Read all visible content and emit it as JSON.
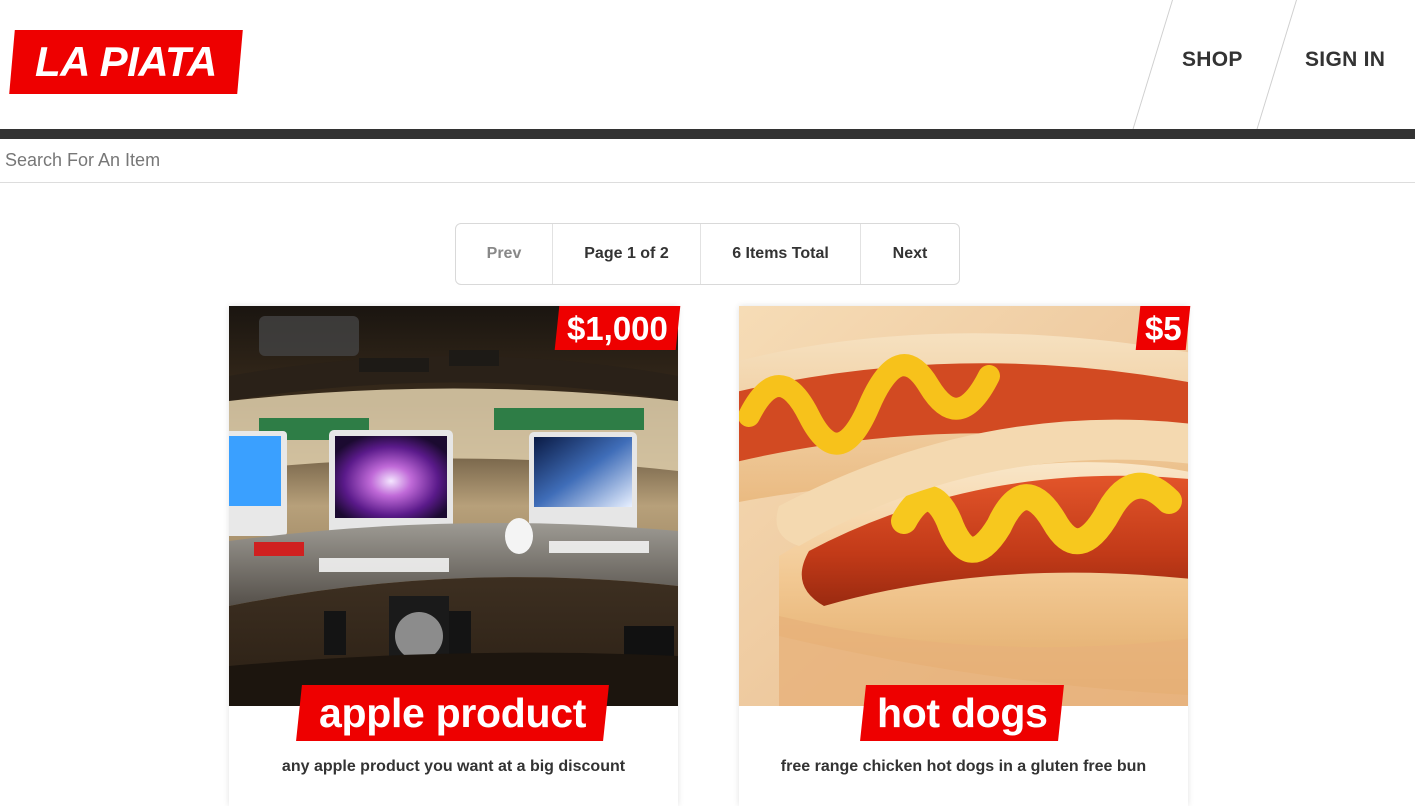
{
  "header": {
    "logo": "LA PIATA",
    "nav": [
      {
        "label": "SHOP"
      },
      {
        "label": "SIGN IN"
      }
    ]
  },
  "search": {
    "placeholder": "Search For An Item",
    "value": ""
  },
  "pagination": {
    "prev_label": "Prev",
    "page_label": "Page 1 of 2",
    "total_label": "6 Items Total",
    "next_label": "Next",
    "current_page": 1,
    "total_pages": 2,
    "total_items": 6
  },
  "products": [
    {
      "title": "apple product",
      "price": "$1,000",
      "description": "any apple product you want at a big discount",
      "image": "apple-store-photo"
    },
    {
      "title": "hot dogs",
      "price": "$5",
      "description": "free range chicken hot dogs in a gluten free bun",
      "image": "hot-dog-photo"
    }
  ],
  "colors": {
    "accent": "#ee0000",
    "dark_bar": "#333333",
    "text": "#333333",
    "muted": "#888888"
  }
}
